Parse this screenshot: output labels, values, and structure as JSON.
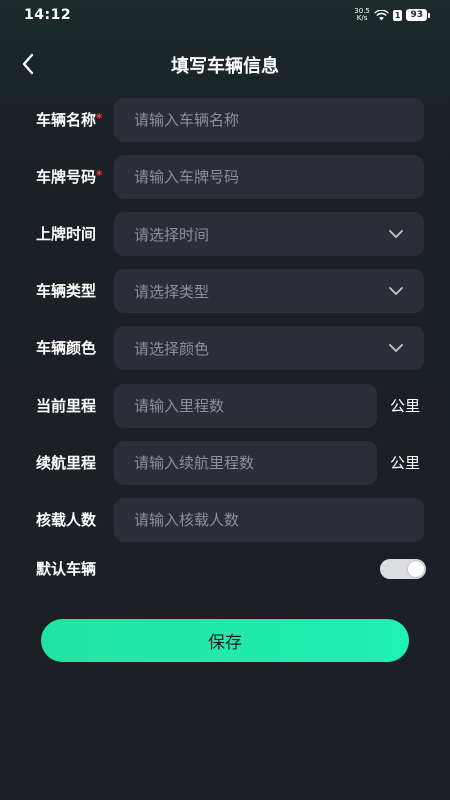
{
  "status_bar": {
    "time": "14:12",
    "net_speed_value": "30.5",
    "net_speed_unit": "K/s",
    "sim_label": "1",
    "battery": "93"
  },
  "header": {
    "title": "填写车辆信息",
    "back_icon": "chevron-left-icon"
  },
  "form": {
    "vehicle_name": {
      "label": "车辆名称",
      "required_mark": "*",
      "placeholder": "请输入车辆名称",
      "value": ""
    },
    "plate_number": {
      "label": "车牌号码",
      "required_mark": "*",
      "placeholder": "请输入车牌号码",
      "value": ""
    },
    "plate_time": {
      "label": "上牌时间",
      "selected": "请选择时间"
    },
    "vehicle_type": {
      "label": "车辆类型",
      "selected": "请选择类型"
    },
    "vehicle_color": {
      "label": "车辆颜色",
      "selected": "请选择颜色"
    },
    "current_mileage": {
      "label": "当前里程",
      "placeholder": "请输入里程数",
      "value": "",
      "unit": "公里"
    },
    "range_mileage": {
      "label": "续航里程",
      "placeholder": "请输入续航里程数",
      "value": "",
      "unit": "公里"
    },
    "seats": {
      "label": "核载人数",
      "placeholder": "请输入核载人数",
      "value": ""
    },
    "default_vehicle": {
      "label": "默认车辆",
      "enabled": true
    }
  },
  "save_button": {
    "label": "保存"
  },
  "colors": {
    "background": "#1c1f26",
    "field_bg": "#2b2e36",
    "accent": "#22e3a4",
    "required": "#ff3b3b",
    "placeholder": "#8c8f98"
  }
}
